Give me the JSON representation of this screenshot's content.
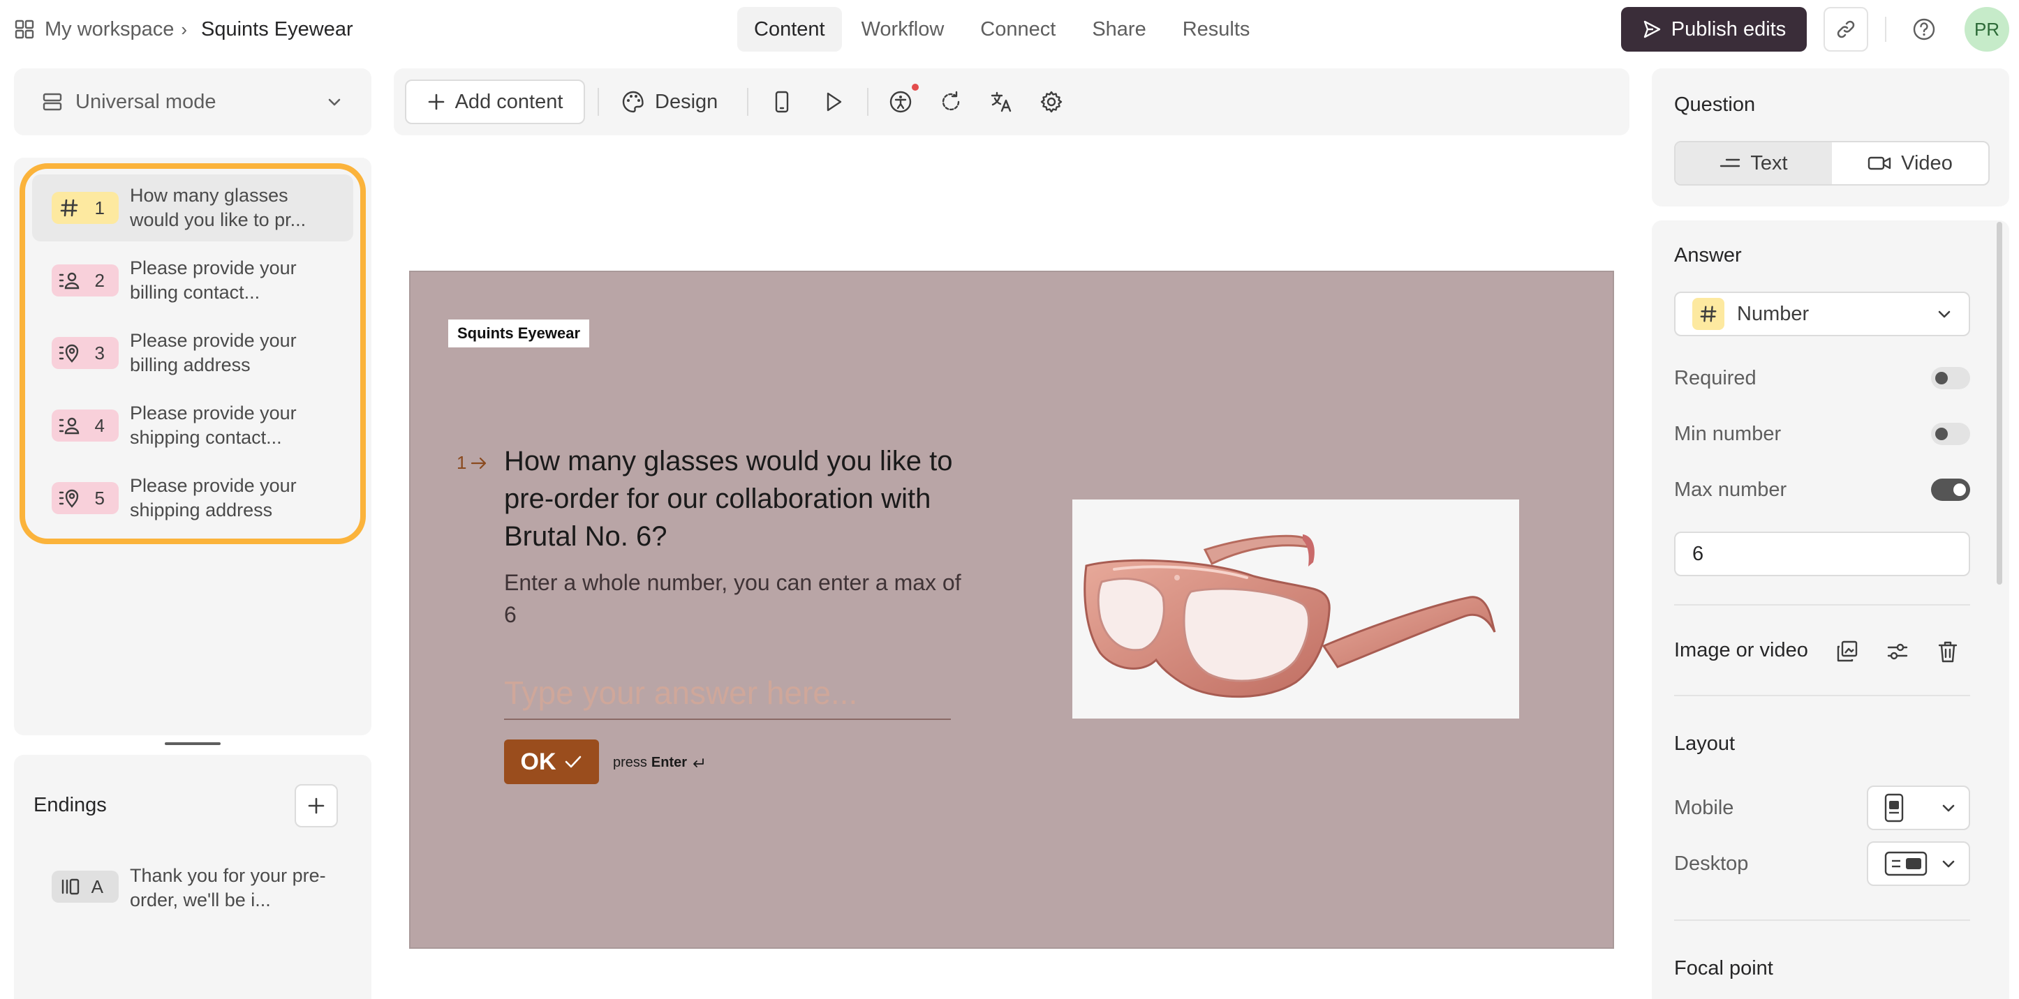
{
  "breadcrumb": {
    "workspace": "My workspace",
    "separator": "›",
    "form_name": "Squints Eyewear"
  },
  "nav": {
    "tabs": [
      {
        "label": "Content"
      },
      {
        "label": "Workflow"
      },
      {
        "label": "Connect"
      },
      {
        "label": "Share"
      },
      {
        "label": "Results"
      }
    ],
    "active": "Content"
  },
  "header": {
    "publish_label": "Publish edits",
    "avatar_initials": "PR"
  },
  "mode": {
    "label": "Universal mode"
  },
  "questions": [
    {
      "number": "1",
      "text": "How many glasses would you like to pr...",
      "icon": "hash-icon",
      "color": "#fde9a0"
    },
    {
      "number": "2",
      "text": "Please provide your billing contact...",
      "icon": "contact-icon",
      "color": "#f8d0da"
    },
    {
      "number": "3",
      "text": "Please provide your billing address",
      "icon": "location-icon",
      "color": "#f8d0da"
    },
    {
      "number": "4",
      "text": "Please provide your shipping contact...",
      "icon": "contact-icon",
      "color": "#f8d0da"
    },
    {
      "number": "5",
      "text": "Please provide your shipping address",
      "icon": "location-icon",
      "color": "#f8d0da"
    }
  ],
  "endings": {
    "title": "Endings",
    "items": [
      {
        "letter": "A",
        "text": "Thank you for your pre-order, we'll be i..."
      }
    ]
  },
  "toolbar": {
    "add_content_label": "Add content",
    "design_label": "Design"
  },
  "canvas": {
    "brand": "Squints Eyewear",
    "question_number": "1",
    "question_title": "How many glasses would you like to pre-order for our collaboration with Brutal No. 6?",
    "question_description": "Enter a whole number, you can enter a max of 6",
    "answer_placeholder": "Type your answer here...",
    "ok_label": "OK",
    "press_label": "press",
    "enter_label": "Enter",
    "background_color": "#b9a5a6",
    "button_color": "#9a4d1d"
  },
  "question_panel": {
    "title": "Question",
    "options": [
      {
        "label": "Text"
      },
      {
        "label": "Video"
      }
    ],
    "selected": "Text"
  },
  "answer_panel": {
    "title": "Answer",
    "type_label": "Number",
    "required_label": "Required",
    "required": false,
    "min_label": "Min number",
    "min_enabled": false,
    "max_label": "Max number",
    "max_enabled": true,
    "max_value": "6",
    "image_label": "Image or video",
    "layout_title": "Layout",
    "mobile_label": "Mobile",
    "desktop_label": "Desktop",
    "focal_label": "Focal point"
  }
}
